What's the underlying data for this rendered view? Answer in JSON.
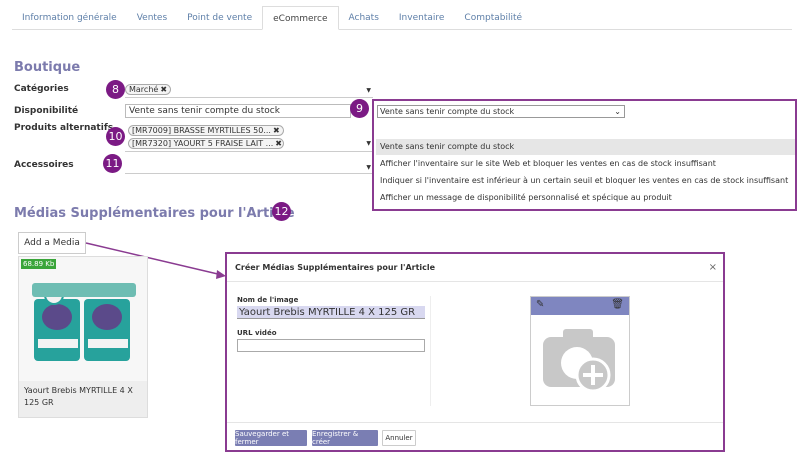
{
  "tabs": [
    {
      "label": "Information générale"
    },
    {
      "label": "Ventes"
    },
    {
      "label": "Point de vente"
    },
    {
      "label": "eCommerce"
    },
    {
      "label": "Achats"
    },
    {
      "label": "Inventaire"
    },
    {
      "label": "Comptabilité"
    }
  ],
  "boutique": {
    "title": "Boutique",
    "categories_label": "Catégories",
    "categories_tag": "Marché",
    "disponibilite_label": "Disponibilité",
    "disponibilite_value": "Vente sans tenir compte du stock",
    "alternatifs_label": "Produits alternatifs",
    "alternatifs": [
      "[MR7009] BRASSE MYRTILLES 50...",
      "[MR7320] YAOURT 5 FRAISE LAIT ..."
    ],
    "accessoires_label": "Accessoires"
  },
  "badges": [
    "8",
    "9",
    "10",
    "11",
    "12"
  ],
  "dropdown": {
    "selected": "Vente sans tenir compte du stock",
    "options": [
      "Vente sans tenir compte du stock",
      "Afficher l'inventaire sur le site Web et bloquer les ventes en cas de stock insuffisant",
      "Indiquer si l'inventaire est inférieur à un certain seuil et bloquer les ventes en cas de stock insuffisant",
      "Afficher un message de disponibilité personnalisé et spécique au produit"
    ]
  },
  "medias": {
    "title": "Médias Supplémentaires pour l'Article",
    "add_label": "Add a Media",
    "card_size": "68.89 Kb",
    "card_caption": "Yaourt Brebis MYRTILLE 4 X 125 GR"
  },
  "modal": {
    "title": "Créer Médias Supplémentaires pour l'Article",
    "close": "×",
    "name_label": "Nom de l'image",
    "name_value": "Yaourt Brebis MYRTILLE 4 X 125 GR",
    "url_label": "URL vidéo",
    "url_value": "",
    "btn_save_close": "Sauvegarder et fermer",
    "btn_save_new": "Enregistrer & créer",
    "btn_cancel": "Annuler"
  },
  "colors": {
    "accent": "#7c7bad",
    "badge": "#7b1a84",
    "highlight_border": "#8a3b91",
    "size_badge": "#3aa53a"
  }
}
